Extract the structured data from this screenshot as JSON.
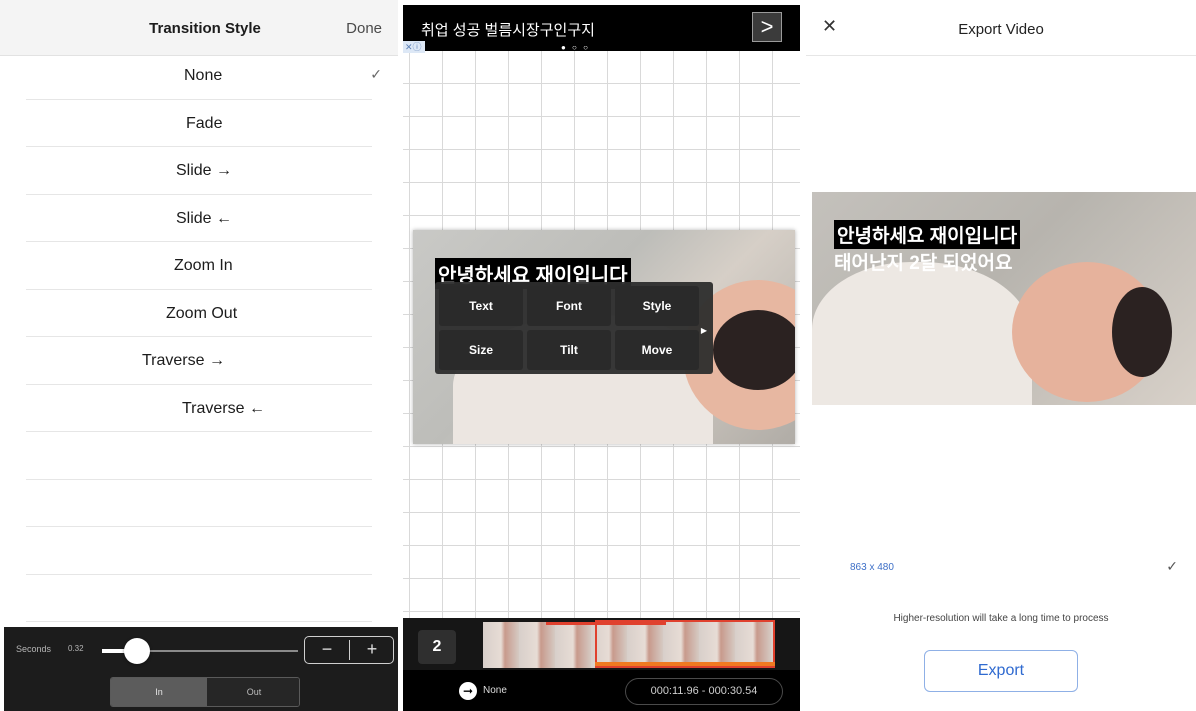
{
  "transition_panel": {
    "title": "Transition Style",
    "done_label": "Done",
    "options": [
      {
        "label": "None",
        "checked": true
      },
      {
        "label": "Fade",
        "checked": false
      },
      {
        "label": "Slide →",
        "checked": false
      },
      {
        "label": "Slide ←",
        "checked": false
      },
      {
        "label": "Zoom In",
        "checked": false
      },
      {
        "label": "Zoom Out",
        "checked": false
      },
      {
        "label": "Traverse →",
        "checked": false
      },
      {
        "label": "Traverse ←",
        "checked": false
      }
    ],
    "check_glyph": "✓",
    "seconds_label": "Seconds",
    "seconds_value": "0.32",
    "minus_label": "−",
    "plus_label": "+",
    "segment_in": "In",
    "segment_out": "Out"
  },
  "editor_panel": {
    "ad_text": "취업 성공 벌름시장구인구지",
    "ad_arrow": ">",
    "ad_close": "✕ⓘ",
    "ad_dots": "● ○ ○",
    "caption": "안녕하세요 재이입니다",
    "menu": [
      "Text",
      "Font",
      "Style",
      "Size",
      "Tilt",
      "Move"
    ],
    "clip_number": "2",
    "transition_label": "None",
    "time_range": "000:11.96 - 000:30.54"
  },
  "export_panel": {
    "close_glyph": "✕",
    "title": "Export Video",
    "caption_line1": "안녕하세요 재이입니다",
    "caption_line2": "태어난지 2달 되었어요",
    "resolution": "863 x 480",
    "check_glyph": "✓",
    "note": "Higher-resolution will take a long time to process",
    "export_label": "Export"
  },
  "colors": {
    "accent_blue": "#2f6ad0",
    "timeline_red": "#e0412e",
    "timeline_orange": "#f07a22"
  }
}
